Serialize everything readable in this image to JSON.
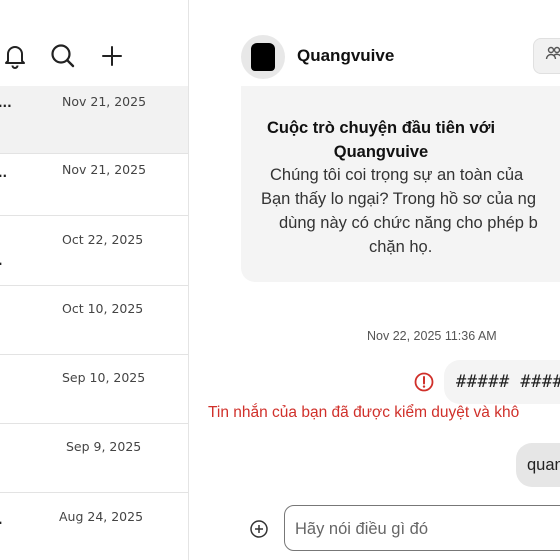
{
  "sidebar": {
    "conversations": [
      {
        "date": "Nov 21, 2025",
        "selected": true,
        "preview_tail": "..."
      },
      {
        "date": "Nov 21, 2025",
        "selected": false,
        "preview_tail": ".."
      },
      {
        "date": "Oct 22, 2025",
        "selected": false,
        "preview_tail": "."
      },
      {
        "date": "Oct 10, 2025",
        "selected": false,
        "preview_tail": ""
      },
      {
        "date": "Sep 10, 2025",
        "selected": false,
        "preview_tail": ""
      },
      {
        "date": "Sep 9, 2025",
        "selected": false,
        "preview_tail": ""
      },
      {
        "date": "Aug 24, 2025",
        "selected": false,
        "preview_tail": "."
      }
    ]
  },
  "chat": {
    "name": "Quangvuive",
    "intro_title_line1": "Cuộc trò chuyện đầu tiên với",
    "intro_title_line2": "Quangvuive",
    "intro_body_line1": "Chúng tôi coi trọng sự an toàn của",
    "intro_body_line2": "Bạn thấy lo ngại? Trong hồ sơ của ng",
    "intro_body_line3": "dùng này có chức năng cho phép b",
    "intro_body_line4": "chặn họ.",
    "timestamp": "Nov 22, 2025 11:36 AM",
    "moderated_message": "##### ####",
    "moderation_note": "Tin nhắn của bạn đã được kiểm duyệt và khô",
    "second_message": "quan",
    "compose_placeholder": "Hãy nói điều gì đó"
  },
  "colors": {
    "error_red": "#d0302a",
    "bubble_gray": "#f4f4f4"
  },
  "icons": [
    "bell-icon",
    "search-icon",
    "plus-icon",
    "people-icon",
    "error-icon",
    "add-circle-icon"
  ]
}
